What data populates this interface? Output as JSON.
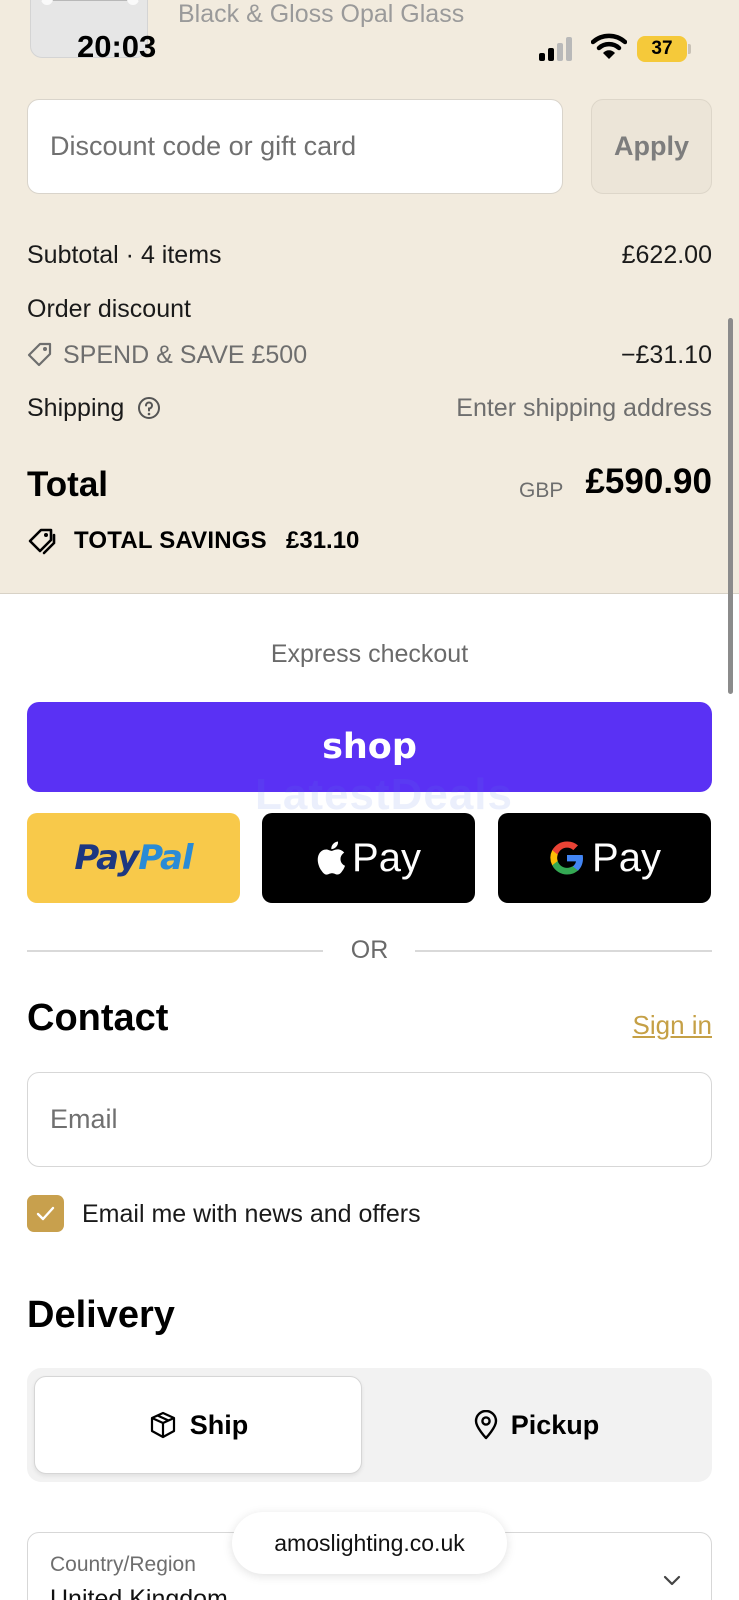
{
  "status_bar": {
    "time": "20:03",
    "battery": "37"
  },
  "order_summary": {
    "product_variant": "Black & Gloss Opal Glass",
    "discount_placeholder": "Discount code or gift card",
    "apply_label": "Apply",
    "subtotal_label": "Subtotal · 4 items",
    "subtotal_value": "£622.00",
    "order_discount_label": "Order discount",
    "discount_code": "SPEND & SAVE £500",
    "discount_value": "−£31.10",
    "shipping_label": "Shipping",
    "shipping_value": "Enter shipping address",
    "total_label": "Total",
    "total_currency": "GBP",
    "total_value": "£590.90",
    "savings_label": "TOTAL SAVINGS",
    "savings_value": "£31.10"
  },
  "express_checkout": {
    "title": "Express checkout",
    "shop_label": "shop",
    "paypal_part1": "Pay",
    "paypal_part2": "Pal",
    "apple_pay_label": "Pay",
    "google_pay_label": "Pay",
    "or_label": "OR"
  },
  "watermark": "LatestDeals",
  "contact": {
    "title": "Contact",
    "sign_in": "Sign in",
    "email_placeholder": "Email",
    "newsletter_label": "Email me with news and offers",
    "newsletter_checked": true
  },
  "delivery": {
    "title": "Delivery",
    "ship_label": "Ship",
    "pickup_label": "Pickup",
    "selected": "Ship",
    "country_label": "Country/Region",
    "country_value": "United Kingdom"
  },
  "browser": {
    "url": "amoslighting.co.uk"
  },
  "colors": {
    "summary_bg": "#f2ebde",
    "shop_purple": "#5a31f4",
    "paypal_yellow": "#f8c94a",
    "accent_gold": "#c8a04d"
  }
}
